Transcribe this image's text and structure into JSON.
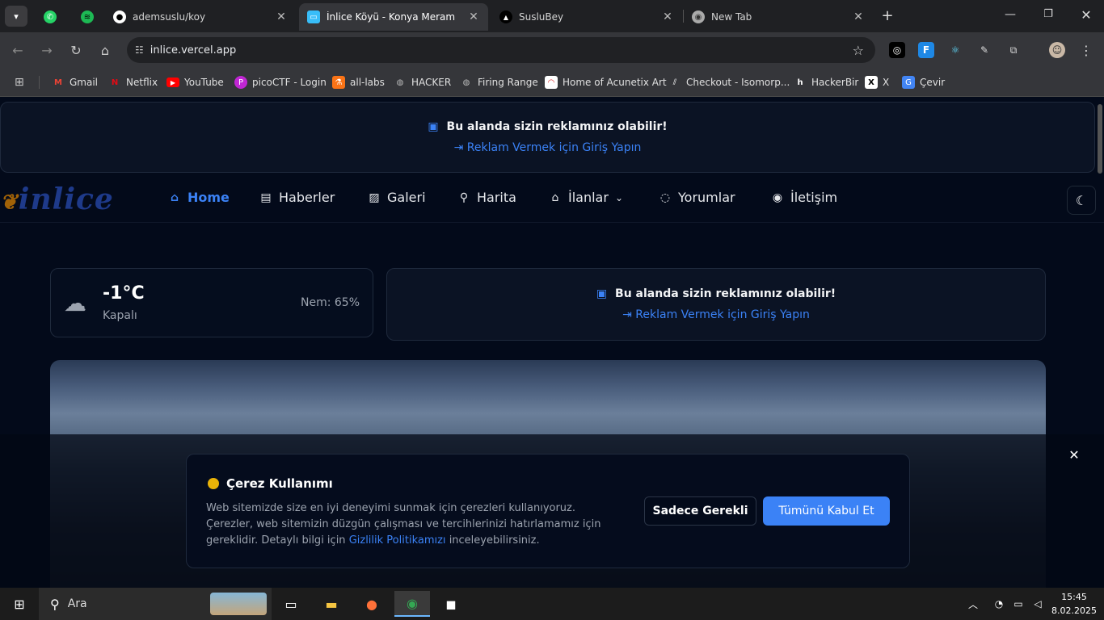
{
  "browser": {
    "tabs": [
      {
        "label": "",
        "icon": "whatsapp-icon",
        "color": "#25d366"
      },
      {
        "label": "",
        "icon": "spotify-icon",
        "color": "#1db954"
      },
      {
        "label": "ademsuslu/koy",
        "icon": "github-icon",
        "color": "#ffffff"
      },
      {
        "label": "İnlice Köyü - Konya Meram",
        "icon": "site-icon",
        "color": "#38bdf8",
        "active": true
      },
      {
        "label": "SusluBey",
        "icon": "triangle-icon",
        "color": "#ffffff"
      },
      {
        "label": "New Tab",
        "icon": "chrome-icon",
        "color": "#cccccc"
      }
    ],
    "url": "inlice.vercel.app",
    "bookmarks": [
      {
        "label": "Gmail",
        "icon": "gmail-icon",
        "color": "#ea4335"
      },
      {
        "label": "Netflix",
        "icon": "netflix-icon",
        "color": "#e50914"
      },
      {
        "label": "YouTube",
        "icon": "youtube-icon",
        "color": "#ff0000"
      },
      {
        "label": "picoCTF - Login",
        "icon": "picoctf-icon",
        "color": "#c026d3"
      },
      {
        "label": "all-labs",
        "icon": "labs-icon",
        "color": "#f97316"
      },
      {
        "label": "HACKER",
        "icon": "globe-icon",
        "color": "#9ca3af"
      },
      {
        "label": "Firing Range",
        "icon": "globe-icon",
        "color": "#9ca3af"
      },
      {
        "label": "Home of Acunetix Art",
        "icon": "acunetix-icon",
        "color": "#dc2626"
      },
      {
        "label": "Checkout - Isomorp...",
        "icon": "checkout-icon",
        "color": "#ffffff"
      },
      {
        "label": "HackerBir",
        "icon": "hackerbir-icon",
        "color": "#ffffff"
      },
      {
        "label": "X",
        "icon": "x-icon",
        "color": "#ffffff"
      },
      {
        "label": "Çevir",
        "icon": "translate-icon",
        "color": "#4285f4"
      }
    ]
  },
  "ads": {
    "title": "Bu alanda sizin reklamınız olabilir!",
    "link": "⇥ Reklam Vermek için Giriş Yapın"
  },
  "site": {
    "logo": "inlice",
    "nav": [
      {
        "label": "Home",
        "icon": "home-icon",
        "active": true
      },
      {
        "label": "Haberler",
        "icon": "newspaper-icon"
      },
      {
        "label": "Galeri",
        "icon": "image-icon"
      },
      {
        "label": "Harita",
        "icon": "map-pin-icon"
      },
      {
        "label": "İlanlar",
        "icon": "house-icon",
        "dropdown": true
      },
      {
        "label": "Yorumlar",
        "icon": "comment-icon"
      },
      {
        "label": "İletişim",
        "icon": "contact-icon"
      }
    ]
  },
  "weather": {
    "temp": "-1°C",
    "condition": "Kapalı",
    "humidity": "Nem: 65%"
  },
  "cookie": {
    "title": "Çerez Kullanımı",
    "text1": "Web sitemizde size en iyi deneyimi sunmak için çerezleri kullanıyoruz.",
    "text2": "Çerezler, web sitemizin düzgün çalışması ve tercihlerinizi hatırlamamız için",
    "text3a": "gereklidir. Detaylı bilgi için",
    "link": "Gizlilik Politikamızı",
    "text3b": "inceleyebilirsiniz.",
    "btn_necessary": "Sadece Gerekli",
    "btn_accept": "Tümünü Kabul Et",
    "accent": "#3b82f6"
  },
  "taskbar": {
    "search": "Ara",
    "time": "15:45",
    "date": "8.02.2025"
  }
}
